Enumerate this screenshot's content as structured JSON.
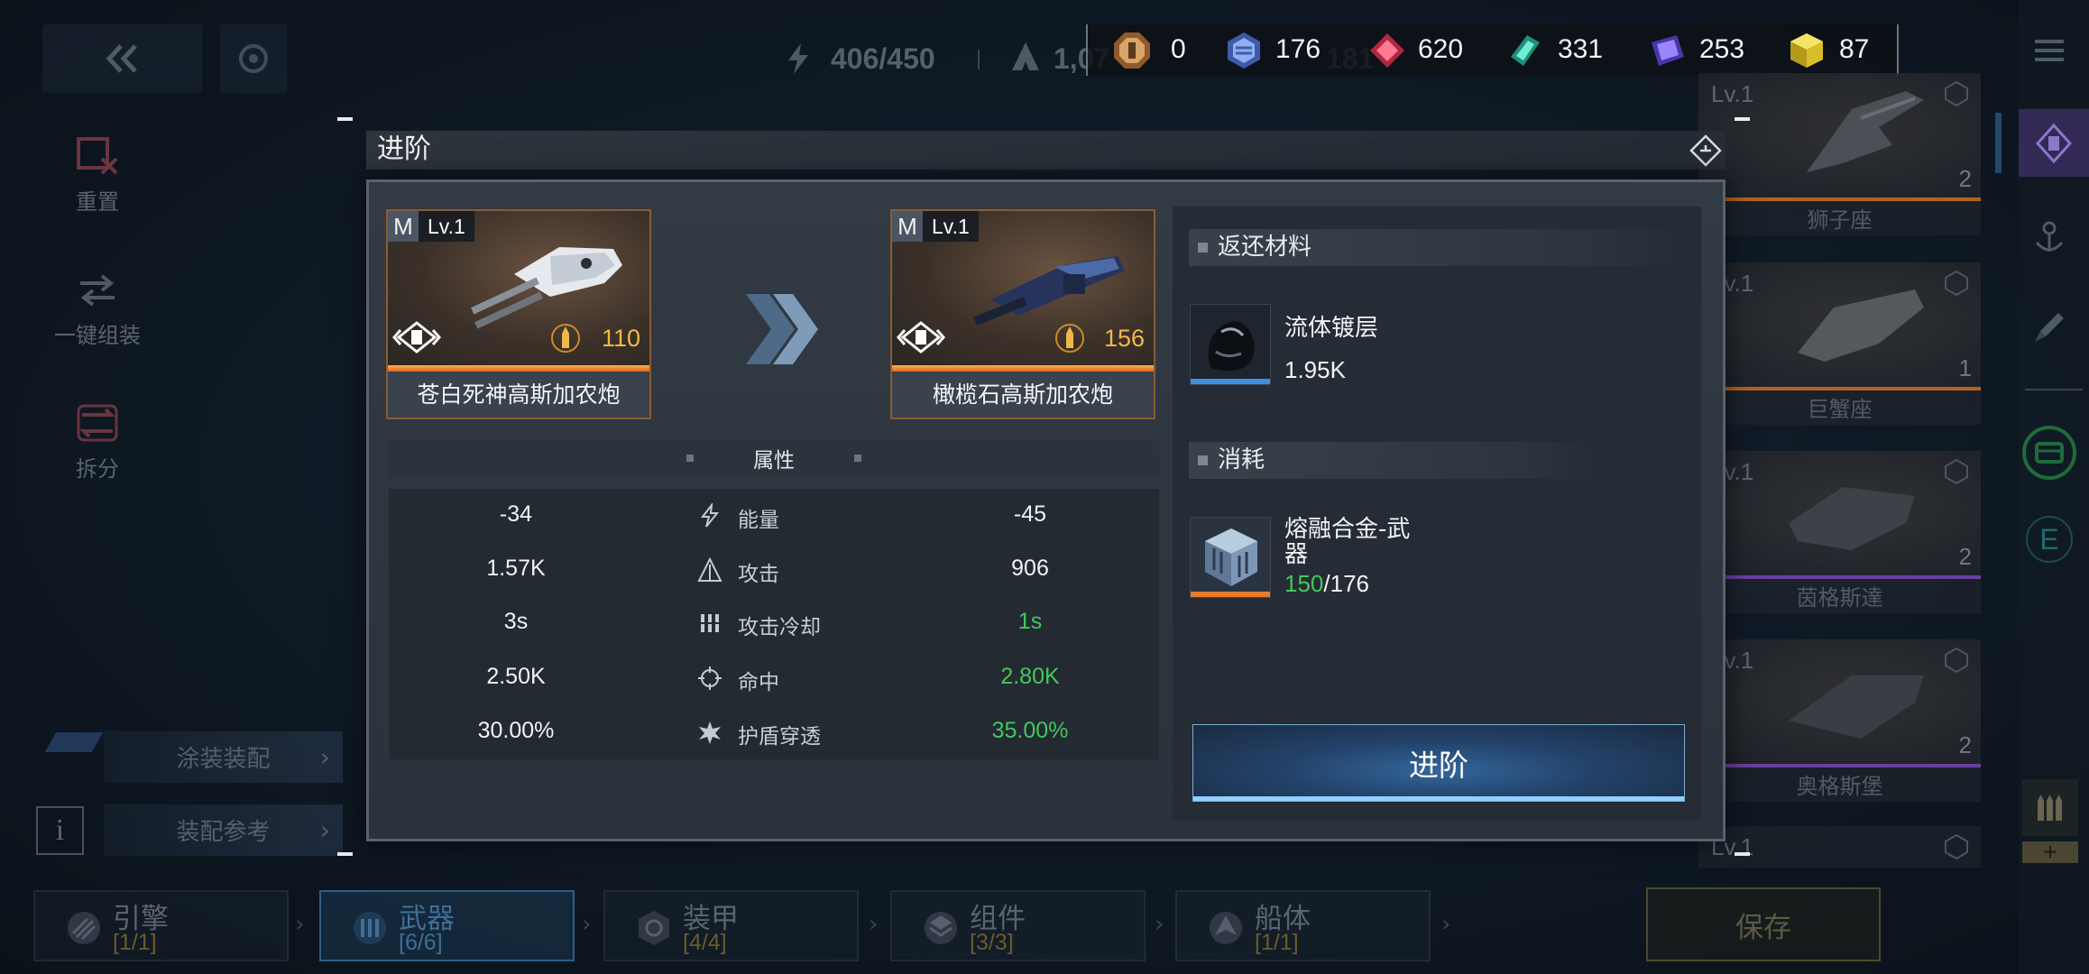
{
  "top_bar": {
    "back_icon": "double-chevron-left-icon",
    "settings_icon": "ring-icon",
    "energy": "406/450",
    "power_partial": "1,07",
    "extra_partial": "181"
  },
  "currencies": [
    {
      "icon": "medal-icon",
      "value": "0",
      "color": "#c98a4a"
    },
    {
      "icon": "blue-crystal-icon",
      "value": "176",
      "color": "#6d8fd6"
    },
    {
      "icon": "red-gem-icon",
      "value": "620",
      "color": "#e0506a"
    },
    {
      "icon": "teal-crystal-icon",
      "value": "331",
      "color": "#3fc9b0"
    },
    {
      "icon": "purple-chip-icon",
      "value": "253",
      "color": "#7a62e0"
    },
    {
      "icon": "yellow-cube-icon",
      "value": "87",
      "color": "#e6c93a"
    }
  ],
  "sidebar": {
    "items": [
      {
        "label": "重置",
        "icon": "reset-icon"
      },
      {
        "label": "一键组装",
        "icon": "auto-assemble-icon"
      },
      {
        "label": "拆分",
        "icon": "split-icon"
      }
    ]
  },
  "bottom_left": {
    "paint_label": "涂装装配",
    "reference_label": "装配参考",
    "info_label": "i"
  },
  "tabs": [
    {
      "label": "引擎",
      "count": "[1/1]"
    },
    {
      "label": "武器",
      "count": "[6/6]",
      "selected": true
    },
    {
      "label": "装甲",
      "count": "[4/4]"
    },
    {
      "label": "组件",
      "count": "[3/3]"
    },
    {
      "label": "船体",
      "count": "[1/1]"
    }
  ],
  "save_label": "保存",
  "ships": [
    {
      "level": "Lv.1",
      "name": "狮子座",
      "count": "2"
    },
    {
      "level": "Lv.1",
      "name": "巨蟹座",
      "count": "1"
    },
    {
      "level": "Lv.1",
      "name": "茵格斯達",
      "count": "2"
    },
    {
      "level": "Lv.1",
      "name": "奥格斯堡",
      "count": "2"
    },
    {
      "level": "Lv.1"
    }
  ],
  "right_rail": {
    "e_label": "E",
    "plus_label": "+"
  },
  "modal": {
    "title": "进阶",
    "from": {
      "grade": "M",
      "level": "Lv.1",
      "power": "110",
      "name": "苍白死神高斯加农炮"
    },
    "to": {
      "grade": "M",
      "level": "Lv.1",
      "power": "156",
      "name": "橄榄石高斯加农炮"
    },
    "attributes_title": "属性",
    "attributes": [
      {
        "label": "能量",
        "from": "-34",
        "to": "-45",
        "improved": false
      },
      {
        "label": "攻击",
        "from": "1.57K",
        "to": "906",
        "improved": false
      },
      {
        "label": "攻击冷却",
        "from": "3s",
        "to": "1s",
        "improved": true
      },
      {
        "label": "命中",
        "from": "2.50K",
        "to": "2.80K",
        "improved": true
      },
      {
        "label": "护盾穿透",
        "from": "30.00%",
        "to": "35.00%",
        "improved": true
      }
    ],
    "returned": {
      "title": "返还材料",
      "item": {
        "name": "流体镀层",
        "amount": "1.95K"
      }
    },
    "cost": {
      "title": "消耗",
      "item": {
        "name": "熔融合金-武器",
        "have": "150",
        "need": "/176"
      }
    },
    "confirm_label": "进阶"
  },
  "colors": {
    "improved": "#43c85c",
    "rarity_orange": "#e6631c",
    "returned_bar": "#3e8fe0",
    "cost_bar": "#e57a2a",
    "power": "#f0b848"
  }
}
